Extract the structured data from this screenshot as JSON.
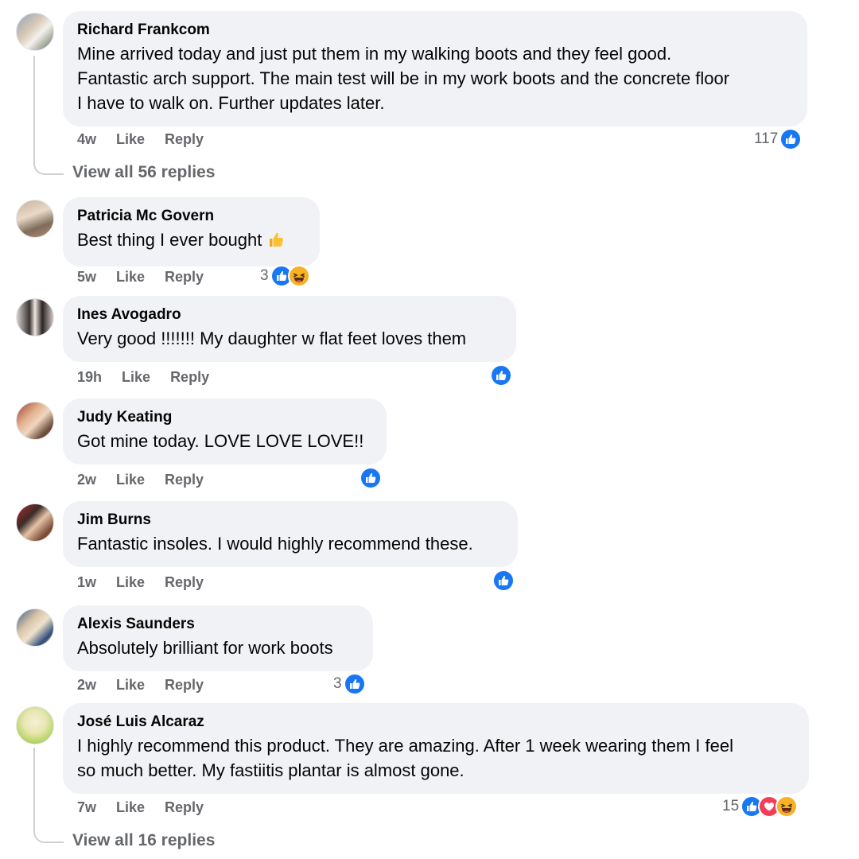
{
  "comments": [
    {
      "author": "Richard Frankcom",
      "lines": [
        "Mine arrived today and just put them in my walking boots and they feel good.",
        "Fantastic arch support. The main test will be in my work boots and the concrete floor",
        "I have to walk on. Further updates later."
      ],
      "time": "4w",
      "like": "Like",
      "reply": "Reply",
      "reaction_count": "117",
      "reactions": [
        "like"
      ],
      "view_replies": "View all 56 replies"
    },
    {
      "author": "Patricia Mc Govern",
      "lines": [
        "Best thing I ever bought"
      ],
      "inline_emoji": "thumbs-up-emoji",
      "time": "5w",
      "like": "Like",
      "reply": "Reply",
      "reaction_count": "3",
      "reactions": [
        "like",
        "haha"
      ]
    },
    {
      "author": "Ines Avogadro",
      "lines": [
        "Very good !!!!!!! My daughter w flat feet loves them"
      ],
      "time": "19h",
      "like": "Like",
      "reply": "Reply",
      "reaction_count": "",
      "reactions": [
        "like"
      ]
    },
    {
      "author": "Judy Keating",
      "lines": [
        "Got mine today. LOVE LOVE LOVE!!"
      ],
      "time": "2w",
      "like": "Like",
      "reply": "Reply",
      "reaction_count": "",
      "reactions": [
        "like"
      ]
    },
    {
      "author": "Jim Burns",
      "lines": [
        "Fantastic insoles. I would highly recommend these."
      ],
      "time": "1w",
      "like": "Like",
      "reply": "Reply",
      "reaction_count": "",
      "reactions": [
        "like"
      ]
    },
    {
      "author": "Alexis Saunders",
      "lines": [
        "Absolutely brilliant for work boots"
      ],
      "time": "2w",
      "like": "Like",
      "reply": "Reply",
      "reaction_count": "3",
      "reactions": [
        "like"
      ]
    },
    {
      "author": "José Luis Alcaraz",
      "lines": [
        "I highly recommend this product. They are amazing. After 1 week wearing them I feel",
        "so much better. My fastiitis plantar is almost gone."
      ],
      "time": "7w",
      "like": "Like",
      "reply": "Reply",
      "reaction_count": "15",
      "reactions": [
        "like",
        "love",
        "haha"
      ],
      "view_replies": "View all 16 replies"
    }
  ],
  "colors": {
    "bubble_bg": "#f0f2f5",
    "meta_text": "#65676b",
    "like_blue": "#1877f2",
    "love_red": "#f33e58",
    "haha_yellow": "#f7b125",
    "thread_line": "#ced0d4"
  }
}
